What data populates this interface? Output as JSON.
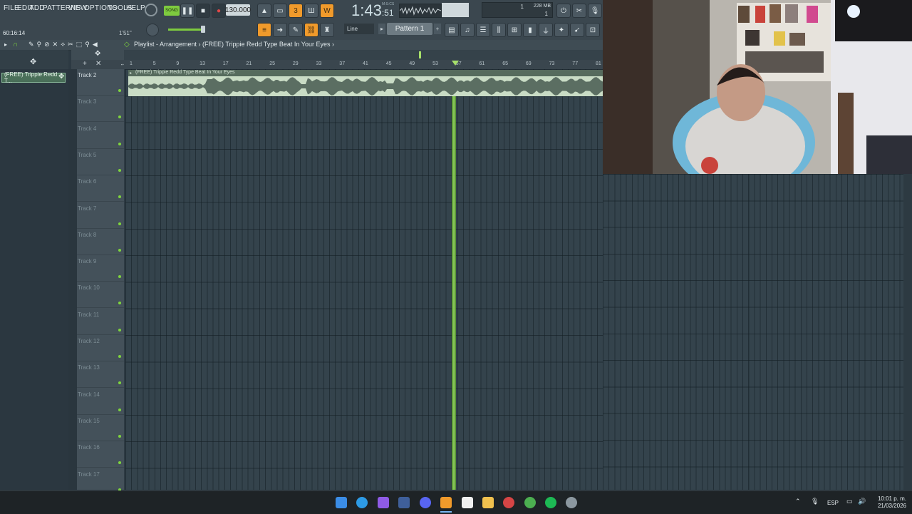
{
  "menu": [
    "FILE",
    "EDIT",
    "ADD",
    "PATTERNS",
    "VIEW",
    "OPTIONS",
    "TOOLS",
    "HELP"
  ],
  "transport": {
    "song_label": "SONG",
    "tempo": "130.000",
    "time_main": "1:43",
    "time_sub": ":51",
    "time_units": "M:S:CS",
    "memory": "228 MB",
    "cpu_top": "1",
    "cpu_bottom": "1"
  },
  "hint_bar": {
    "counter": "60:16:14",
    "small_time": "1'51\""
  },
  "toolbar": {
    "snap": "Line",
    "pattern": "Pattern 1"
  },
  "playlist": {
    "breadcrumb": "Playlist - Arrangement › (FREE) Trippie Redd Type Beat In Your Eyes ›",
    "clip_name": "(FREE) Trippie Redd Type Beat In Your Eyes",
    "browser_clip": "(FREE) Trippie Redd T...",
    "ruler": [
      "1",
      "5",
      "9",
      "13",
      "17",
      "21",
      "25",
      "29",
      "33",
      "37",
      "41",
      "45",
      "49",
      "53",
      "57",
      "61",
      "65",
      "69",
      "73",
      "77",
      "81"
    ],
    "tracks": [
      "Track 2",
      "Track 3",
      "Track 4",
      "Track 5",
      "Track 6",
      "Track 7",
      "Track 8",
      "Track 9",
      "Track 10",
      "Track 11",
      "Track 12",
      "Track 13",
      "Track 14",
      "Track 15",
      "Track 16",
      "Track 17"
    ]
  },
  "taskbar": {
    "lang": "ESP",
    "time": "10:01 p. m.",
    "date": "21/03/2026"
  },
  "colors": {
    "accent_orange": "#f09a2b",
    "playhead_green": "#8fdc4e",
    "clip_green": "#c9dcc5"
  }
}
